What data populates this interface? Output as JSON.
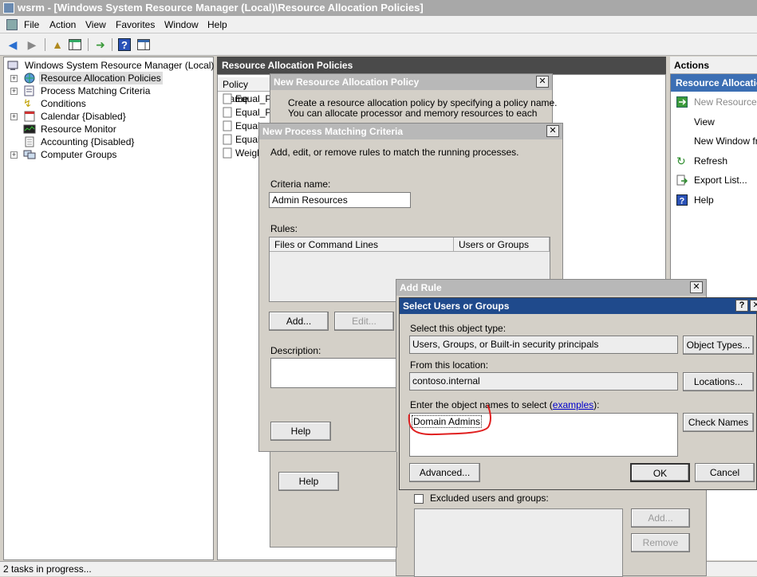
{
  "window": {
    "title": "wsrm - [Windows System Resource Manager (Local)\\Resource Allocation Policies]"
  },
  "menu": [
    "File",
    "Action",
    "View",
    "Favorites",
    "Window",
    "Help"
  ],
  "tree": {
    "root": "Windows System Resource Manager (Local)",
    "items": [
      "Resource Allocation Policies",
      "Process Matching Criteria",
      "Conditions",
      "Calendar  {Disabled}",
      "Resource Monitor",
      "Accounting  {Disabled}",
      "Computer Groups"
    ]
  },
  "middle": {
    "header": "Resource Allocation Policies",
    "column": "Policy Name",
    "rows": [
      "Equal_Pe",
      "Equal_Pe",
      "Equal_",
      "Equal_",
      "Weigh"
    ]
  },
  "actions": {
    "header": "Actions",
    "subheader": "Resource Allocatio",
    "items": [
      "New Resource A",
      "View",
      "New Window fro",
      "Refresh",
      "Export List...",
      "Help"
    ]
  },
  "status": "2 tasks in progress...",
  "dlg_policy": {
    "title": "New Resource Allocation Policy",
    "line1": "Create a resource allocation policy by specifying a policy name.",
    "line2": "You can allocate processor and memory resources to each"
  },
  "dlg_pmc": {
    "title": "New Process Matching Criteria",
    "intro": "Add, edit, or remove rules to match the running processes.",
    "criteria_label": "Criteria name:",
    "criteria_value": "Admin Resources",
    "rules_label": "Rules:",
    "col1": "Files or Command Lines",
    "col2": "Users or Groups",
    "add": "Add...",
    "edit": "Edit...",
    "desc_label": "Description:",
    "help": "Help"
  },
  "dlg_addrule": {
    "title": "Add Rule",
    "help": "Help",
    "excluded": "Excluded users and groups:",
    "add": "Add...",
    "remove": "Remove"
  },
  "dlg_select": {
    "title": "Select Users or Groups",
    "qmark": "?",
    "type_label": "Select this object type:",
    "type_value": "Users, Groups, or Built-in security principals",
    "object_types": "Object Types...",
    "loc_label": "From this location:",
    "loc_value": "contoso.internal",
    "locations": "Locations...",
    "enter_label": "Enter the object names to select (",
    "examples": "examples",
    "enter_suffix": "):",
    "names_value": "Domain Admins",
    "check_names": "Check Names",
    "advanced": "Advanced...",
    "ok": "OK",
    "cancel": "Cancel"
  },
  "colors": {
    "accent": "#1f4a8c",
    "annotation": "#e02020"
  }
}
